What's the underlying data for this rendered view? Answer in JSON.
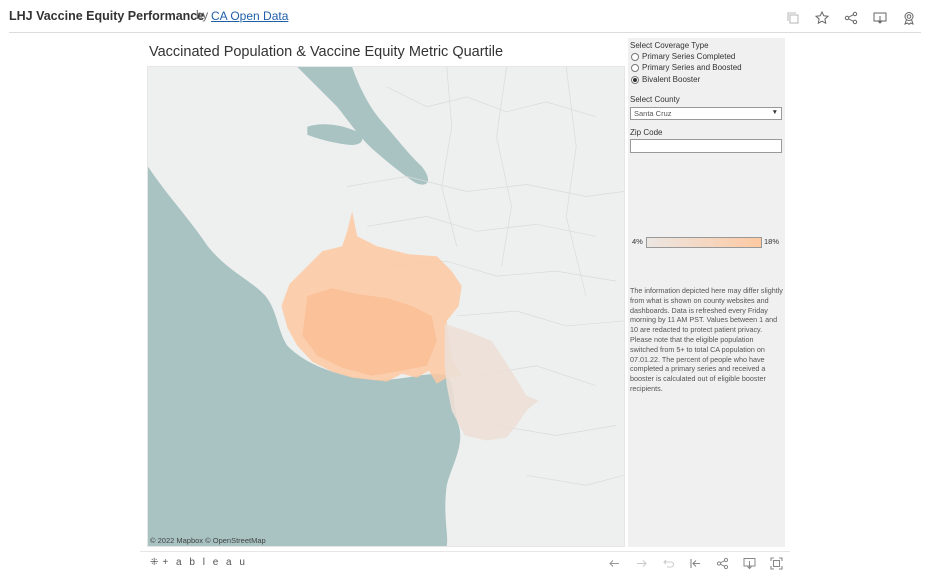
{
  "header": {
    "title": "LHJ Vaccine Equity Performance",
    "by": "by",
    "author": "CA Open Data",
    "icons": [
      "copy-icon",
      "star-icon",
      "share-icon",
      "download-icon",
      "badge-icon"
    ]
  },
  "viz": {
    "title": "Vaccinated Population & Vaccine Equity Metric Quartile",
    "map_credit": "© 2022 Mapbox © OpenStreetMap"
  },
  "panel": {
    "coverage_label": "Select Coverage Type",
    "coverage_options": [
      {
        "label": "Primary Series Completed",
        "checked": false
      },
      {
        "label": "Primary Series and Boosted",
        "checked": false
      },
      {
        "label": "Bivalent Booster",
        "checked": true
      }
    ],
    "county_label": "Select County",
    "county_value": "Santa Cruz",
    "zip_label": "Zip Code",
    "zip_value": "",
    "legend_min": "4%",
    "legend_max": "18%",
    "legend_colors": {
      "low": "#ece6e2",
      "high": "#fdc9a2"
    },
    "disclaimer": "The information depicted here may differ slightly from what is shown on county websites and dashboards. Data is refreshed every Friday morning by 11 AM PST. Values between 1 and 10 are redacted to protect patient privacy. Please note that the eligible population switched from 5+ to total CA population on 07.01.22. The percent of people who have completed a primary series and received a booster is calculated out of eligible booster recipients."
  },
  "footer": {
    "logo_text": "+ a b l e a u",
    "icons": [
      "undo-icon",
      "redo-icon",
      "revert-icon",
      "revert-all-icon",
      "share-icon",
      "download-icon",
      "fullscreen-icon"
    ]
  },
  "colors": {
    "water": "#a9c3c3",
    "land": "#eef0ef",
    "accent_link": "#1f5fa8"
  }
}
